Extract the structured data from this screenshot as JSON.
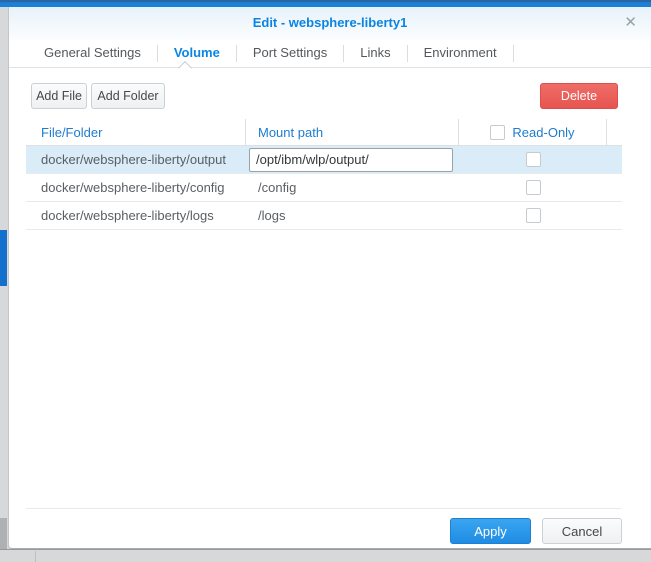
{
  "dialog": {
    "title": "Edit - websphere-liberty1",
    "close_glyph": "✕"
  },
  "tabs": [
    {
      "label": "General Settings",
      "active": false
    },
    {
      "label": "Volume",
      "active": true
    },
    {
      "label": "Port Settings",
      "active": false
    },
    {
      "label": "Links",
      "active": false
    },
    {
      "label": "Environment",
      "active": false
    }
  ],
  "toolbar": {
    "add_file_label": "Add File",
    "add_folder_label": "Add Folder",
    "delete_label": "Delete"
  },
  "table": {
    "columns": [
      "File/Folder",
      "Mount path",
      "Read-Only"
    ],
    "header_checkbox_checked": false,
    "rows": [
      {
        "file_folder": "docker/websphere-liberty/output",
        "mount_path": "/opt/ibm/wlp/output/",
        "read_only": false,
        "selected": true,
        "editing": true
      },
      {
        "file_folder": "docker/websphere-liberty/config",
        "mount_path": "/config",
        "read_only": false,
        "selected": false,
        "editing": false
      },
      {
        "file_folder": "docker/websphere-liberty/logs",
        "mount_path": "/logs",
        "read_only": false,
        "selected": false,
        "editing": false
      }
    ]
  },
  "footer": {
    "apply_label": "Apply",
    "cancel_label": "Cancel"
  },
  "colors": {
    "accent_blue": "#0b84e2",
    "header_text_blue": "#1e7cd0",
    "selected_row": "#d9ecf8",
    "delete_red": "#e75550",
    "apply_blue": "#1f8ce4",
    "top_bar_blue": "#1a80d8"
  }
}
